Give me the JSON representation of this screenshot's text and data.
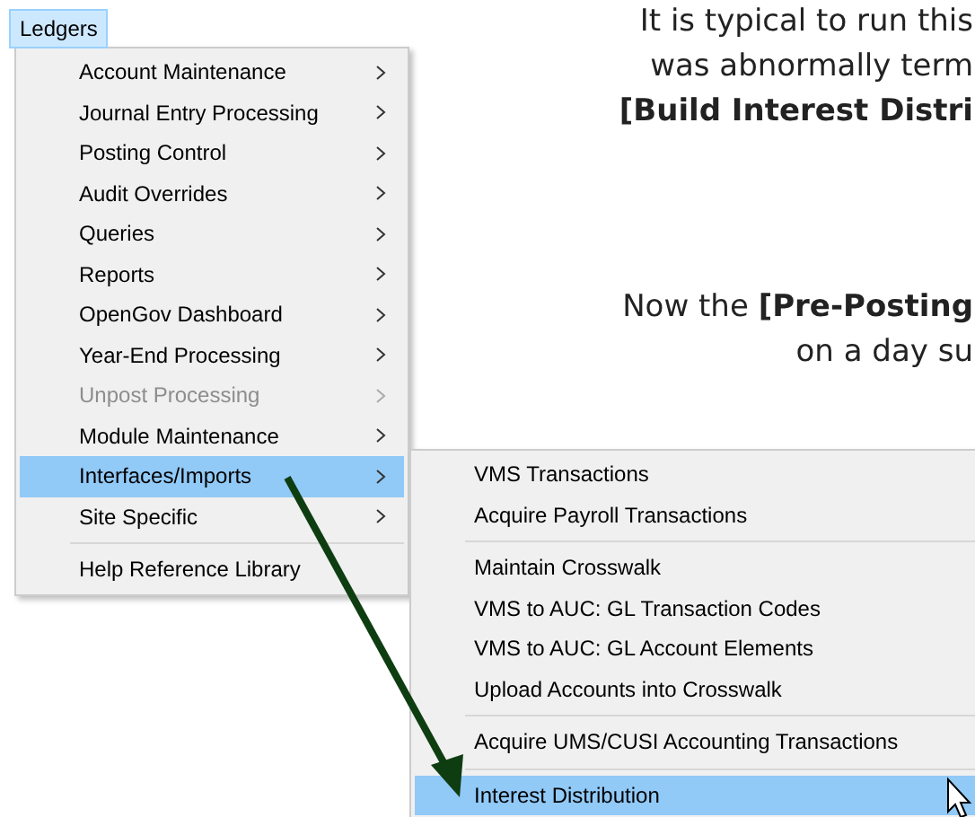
{
  "background_text": [
    {
      "text": "It is typical to run this",
      "bold": false
    },
    {
      "text": "was abnormally term",
      "bold": false
    },
    {
      "text": "[Build Interest Distri",
      "bold": true
    },
    {
      "text": "Now the **[Pre-Posting**",
      "bold": false
    },
    {
      "text": "on a day su",
      "bold": false
    }
  ],
  "menu_bar": {
    "title": "Ledgers",
    "selected": true
  },
  "menu": {
    "groups": [
      [
        {
          "label": "Account Maintenance",
          "submenu": true,
          "disabled": false,
          "selected": false
        },
        {
          "label": "Journal Entry Processing",
          "submenu": true,
          "disabled": false,
          "selected": false
        },
        {
          "label": "Posting Control",
          "submenu": true,
          "disabled": false,
          "selected": false
        },
        {
          "label": "Audit Overrides",
          "submenu": true,
          "disabled": false,
          "selected": false
        },
        {
          "label": "Queries",
          "submenu": true,
          "disabled": false,
          "selected": false
        },
        {
          "label": "Reports",
          "submenu": true,
          "disabled": false,
          "selected": false
        },
        {
          "label": "OpenGov Dashboard",
          "submenu": true,
          "disabled": false,
          "selected": false
        },
        {
          "label": "Year-End Processing",
          "submenu": true,
          "disabled": false,
          "selected": false
        },
        {
          "label": "Unpost Processing",
          "submenu": true,
          "disabled": true,
          "selected": false
        },
        {
          "label": "Module Maintenance",
          "submenu": true,
          "disabled": false,
          "selected": false
        },
        {
          "label": "Interfaces/Imports",
          "submenu": true,
          "disabled": false,
          "selected": true
        },
        {
          "label": "Site Specific",
          "submenu": true,
          "disabled": false,
          "selected": false
        }
      ],
      [
        {
          "label": "Help Reference Library",
          "submenu": false,
          "disabled": false,
          "selected": false
        }
      ]
    ]
  },
  "submenu": {
    "groups": [
      [
        {
          "label": "VMS Transactions",
          "selected": false
        },
        {
          "label": "Acquire Payroll Transactions",
          "selected": false
        }
      ],
      [
        {
          "label": "Maintain Crosswalk",
          "selected": false
        },
        {
          "label": "VMS to AUC: GL Transaction Codes",
          "selected": false
        },
        {
          "label": "VMS to AUC: GL Account Elements",
          "selected": false
        },
        {
          "label": "Upload Accounts into Crosswalk",
          "selected": false
        }
      ],
      [
        {
          "label": "Acquire UMS/CUSI Accounting Transactions",
          "selected": false
        }
      ],
      [
        {
          "label": "Interest Distribution",
          "selected": true
        }
      ]
    ]
  }
}
